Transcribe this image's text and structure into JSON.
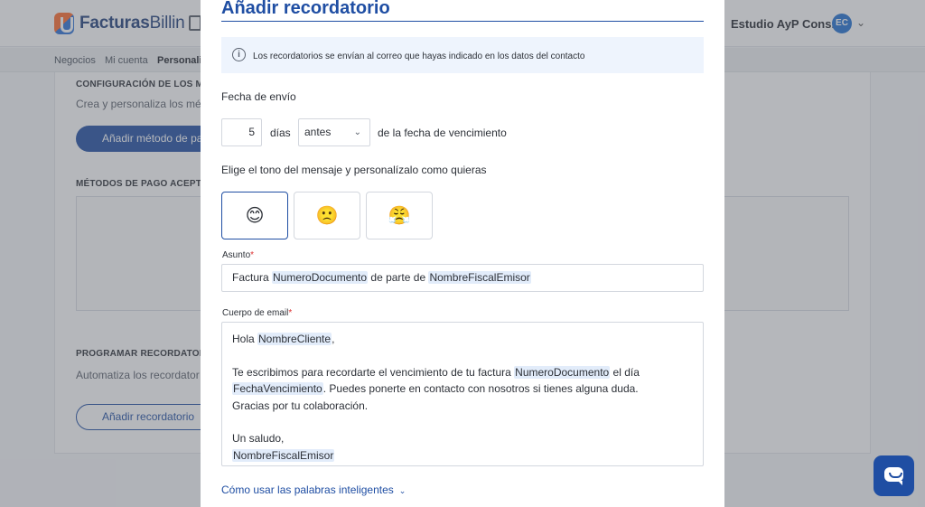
{
  "app": {
    "brand_bold": "Facturas",
    "brand_light": "Billin",
    "account_name": "Estudio AyP Cons...",
    "avatar_initials": "EC"
  },
  "breadcrumbs": [
    "Negocios",
    "Mi cuenta",
    "Personaliz"
  ],
  "background": {
    "section1_title": "CONFIGURACIÓN DE LOS MÉ",
    "section1_desc": "Crea y personaliza los mé",
    "add_payment_button": "Añadir método de pa",
    "section2_title": "MÉTODOS DE PAGO ACEPTA",
    "section3_title": "PROGRAMAR RECORDATORI",
    "section3_desc": "Automatiza los recordator",
    "add_reminder_button": "Añadir recordatorio"
  },
  "modal": {
    "title": "Añadir recordatorio",
    "info_text": "Los recordatorios se envían al correo que hayas indicado en los datos del contacto",
    "send_date_label": "Fecha de envío",
    "days_value": "5",
    "days_label": "días",
    "when_option": "antes",
    "due_date_label": "de la fecha de vencimiento",
    "tone_label": "Elige el tono del mensaje y personalízalo como quieras",
    "tones": [
      {
        "emoji": "😊",
        "icon": "happy-face-icon",
        "selected": true
      },
      {
        "emoji": "🙁",
        "icon": "sad-face-icon",
        "selected": false
      },
      {
        "emoji": "😤",
        "icon": "angry-face-icon",
        "selected": false
      }
    ],
    "subject_label": "Asunto",
    "subject": {
      "t1": "Factura ",
      "tok1": "NumeroDocumento",
      "t2": " de parte de ",
      "tok2": "NombreFiscalEmisor"
    },
    "body_label": "Cuerpo de email",
    "body": {
      "greeting": "Hola ",
      "tok_client": "NombreCliente",
      "greeting_end": ",",
      "p1_a": "Te escribimos para recordarte el vencimiento de tu factura ",
      "tok_doc": "NumeroDocumento",
      "p1_b": " el día",
      "tok_due": "FechaVencimiento",
      "p1_c": ". Puedes ponerte en contacto con nosotros si tienes alguna duda.",
      "thanks": "Gracias por tu colaboración.",
      "signoff": "Un saludo,",
      "tok_sender": "NombreFiscalEmisor"
    },
    "help_link": "Cómo usar las palabras inteligentes",
    "required_mark": "*"
  },
  "colors": {
    "brand_blue": "#1f4ea3",
    "token_highlight": "#e2ecfa",
    "required": "#dd3333"
  }
}
